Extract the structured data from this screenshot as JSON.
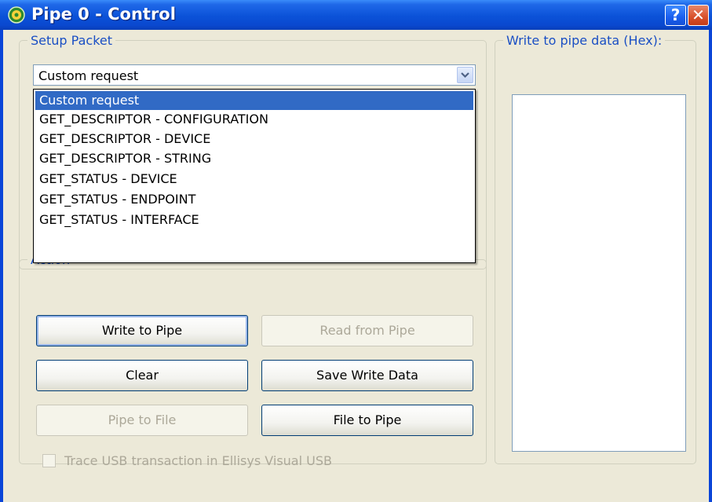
{
  "window": {
    "title": "Pipe 0 - Control",
    "icon": "gear-icon",
    "help_glyph": "?",
    "close_glyph": "✕"
  },
  "setup": {
    "legend": "Setup Packet",
    "selected": "Custom request",
    "options": [
      "Custom request",
      "GET_DESCRIPTOR - CONFIGURATION",
      "GET_DESCRIPTOR - DEVICE",
      "GET_DESCRIPTOR - STRING",
      "GET_STATUS - DEVICE",
      "GET_STATUS - ENDPOINT",
      "GET_STATUS - INTERFACE"
    ]
  },
  "action": {
    "legend": "Action",
    "write_to_pipe": "Write to Pipe",
    "read_from_pipe": "Read from Pipe",
    "clear": "Clear",
    "save_write_data": "Save Write Data",
    "pipe_to_file": "Pipe to File",
    "file_to_pipe": "File to Pipe",
    "trace_label": "Trace USB transaction in Ellisys Visual USB",
    "trace_checked": false
  },
  "write_panel": {
    "legend": "Write to pipe data (Hex):",
    "value": ""
  },
  "colors": {
    "accent": "#316ac5",
    "legend_text": "#1a4fc4",
    "disabled_text": "#aca899"
  }
}
